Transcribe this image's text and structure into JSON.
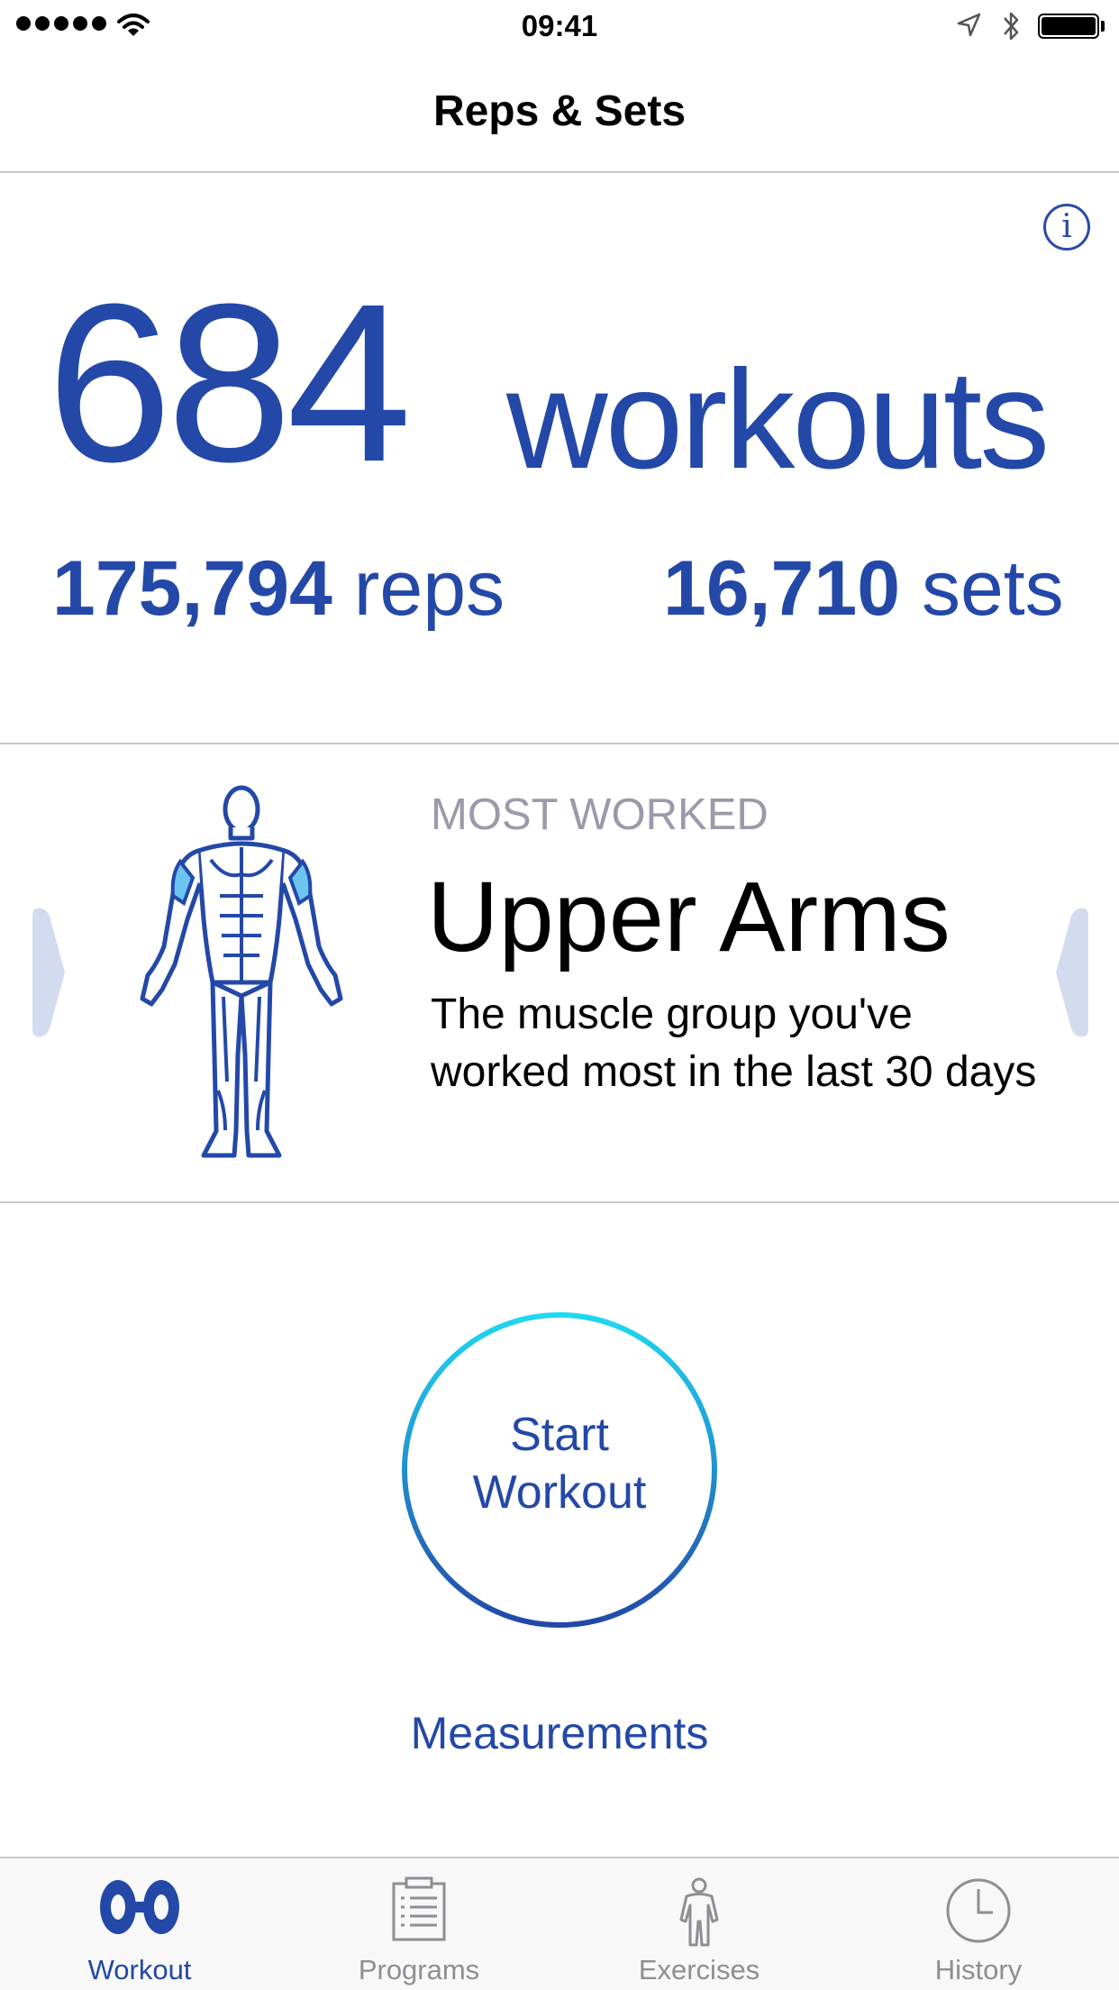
{
  "status_bar": {
    "time": "09:41"
  },
  "nav": {
    "title": "Reps & Sets"
  },
  "stats": {
    "workouts_count": "684",
    "workouts_unit": "workouts",
    "reps_count": "175,794",
    "reps_unit": "reps",
    "sets_count": "16,710",
    "sets_unit": "sets"
  },
  "most_worked": {
    "label": "MOST WORKED",
    "muscle": "Upper Arms",
    "description": "The muscle group you've worked most in the last 30 days"
  },
  "start_workout": {
    "line1": "Start",
    "line2": "Workout"
  },
  "measurements": {
    "label": "Measurements"
  },
  "tabs": [
    {
      "label": "Workout",
      "icon": "dumbbell-icon",
      "active": true
    },
    {
      "label": "Programs",
      "icon": "clipboard-icon",
      "active": false
    },
    {
      "label": "Exercises",
      "icon": "body-icon",
      "active": false
    },
    {
      "label": "History",
      "icon": "clock-icon",
      "active": false
    }
  ],
  "colors": {
    "accent": "#2348a8",
    "ring_top": "#1fd8f2",
    "ring_bottom": "#2348a8",
    "highlight_muscle": "#6cc4f0",
    "chevron": "#d3dcef",
    "muted_label": "#9a9aaa",
    "tab_inactive": "#8e8e93"
  }
}
